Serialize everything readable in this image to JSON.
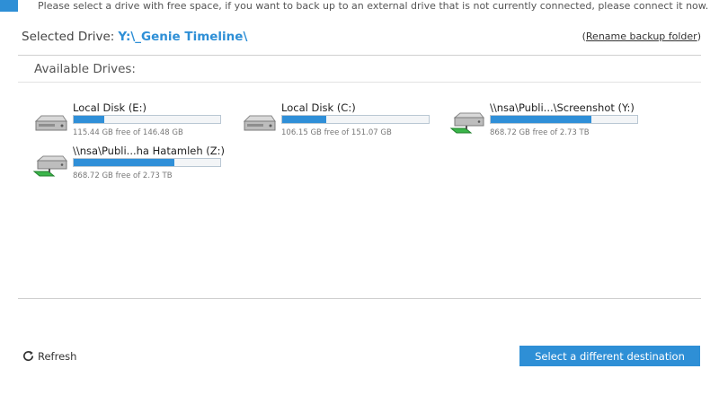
{
  "instruction": "Please select a drive with free space, if you want to back up to an external drive that is not currently connected, please connect it now.",
  "selected": {
    "label": "Selected Drive:",
    "path": "Y:\\_Genie Timeline\\"
  },
  "rename": {
    "open_paren": "(",
    "label": "Rename backup folder",
    "close_paren": ")"
  },
  "panel_title": "Available Drives:",
  "drives": [
    {
      "name": "Local Disk (E:)",
      "free": "115.44 GB free of 146.48 GB",
      "used_fraction": 0.21,
      "icon": "local-disk-icon"
    },
    {
      "name": "Local Disk (C:)",
      "free": "106.15 GB free of 151.07 GB",
      "used_fraction": 0.3,
      "icon": "local-disk-icon"
    },
    {
      "name": "\\\\nsa\\Publi...\\Screenshot (Y:)",
      "free": "868.72 GB free of 2.73 TB",
      "used_fraction": 0.69,
      "icon": "network-drive-icon"
    },
    {
      "name": "\\\\nsa\\Publi...ha Hatamleh (Z:)",
      "free": "868.72 GB free of 2.73 TB",
      "used_fraction": 0.69,
      "icon": "network-drive-icon"
    }
  ],
  "refresh_label": "Refresh",
  "destination_button": "Select a different destination",
  "colors": {
    "accent": "#2e8fd6",
    "bar_fill": "#2f8fd8",
    "network_green": "#3bb54a"
  }
}
